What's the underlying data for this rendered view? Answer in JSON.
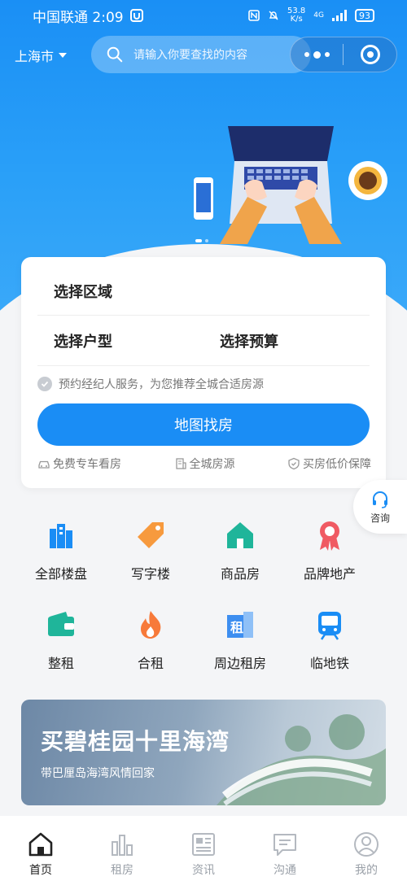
{
  "status_bar": {
    "carrier_time": "中国联通 2:09",
    "net_speed_value": "53.8",
    "net_speed_unit": "K/s",
    "network": "4G",
    "battery": "93"
  },
  "header": {
    "city": "上海市",
    "search_placeholder": "请输入你要查找的内容"
  },
  "filter_card": {
    "area_label": "选择区域",
    "layout_label": "选择户型",
    "budget_label": "选择预算",
    "agreement_text": "预约经纪人服务，为您推荐全城合适房源",
    "cta_label": "地图找房",
    "perks": [
      "免费专车看房",
      "全城房源",
      "买房低价保障"
    ]
  },
  "consult": {
    "label": "咨询"
  },
  "categories": [
    {
      "label": "全部楼盘",
      "icon": "buildings-icon",
      "color": "#1a8df5"
    },
    {
      "label": "写字楼",
      "icon": "tag-icon",
      "color": "#f79a3e"
    },
    {
      "label": "商品房",
      "icon": "house-icon",
      "color": "#1fb59a"
    },
    {
      "label": "品牌地产",
      "icon": "ribbon-icon",
      "color": "#f05a63"
    },
    {
      "label": "整租",
      "icon": "wallet-icon",
      "color": "#1fb59a"
    },
    {
      "label": "合租",
      "icon": "fire-icon",
      "color": "#f77a3a"
    },
    {
      "label": "周边租房",
      "icon": "rent-building-icon",
      "color": "#3d8ef0"
    },
    {
      "label": "临地铁",
      "icon": "subway-icon",
      "color": "#1a8df5"
    }
  ],
  "banner": {
    "title": "买碧桂园十里海湾",
    "subtitle": "带巴厘岛海湾风情回家"
  },
  "tabs": [
    {
      "label": "首页",
      "icon": "home-icon",
      "active": true
    },
    {
      "label": "租房",
      "icon": "bar-chart-icon",
      "active": false
    },
    {
      "label": "资讯",
      "icon": "news-icon",
      "active": false
    },
    {
      "label": "沟通",
      "icon": "chat-icon",
      "active": false
    },
    {
      "label": "我的",
      "icon": "user-icon",
      "active": false
    }
  ],
  "colors": {
    "primary": "#1a8df5",
    "hero_gradient_top": "#1a8ff5",
    "hero_gradient_bottom": "#3ba9f9"
  }
}
